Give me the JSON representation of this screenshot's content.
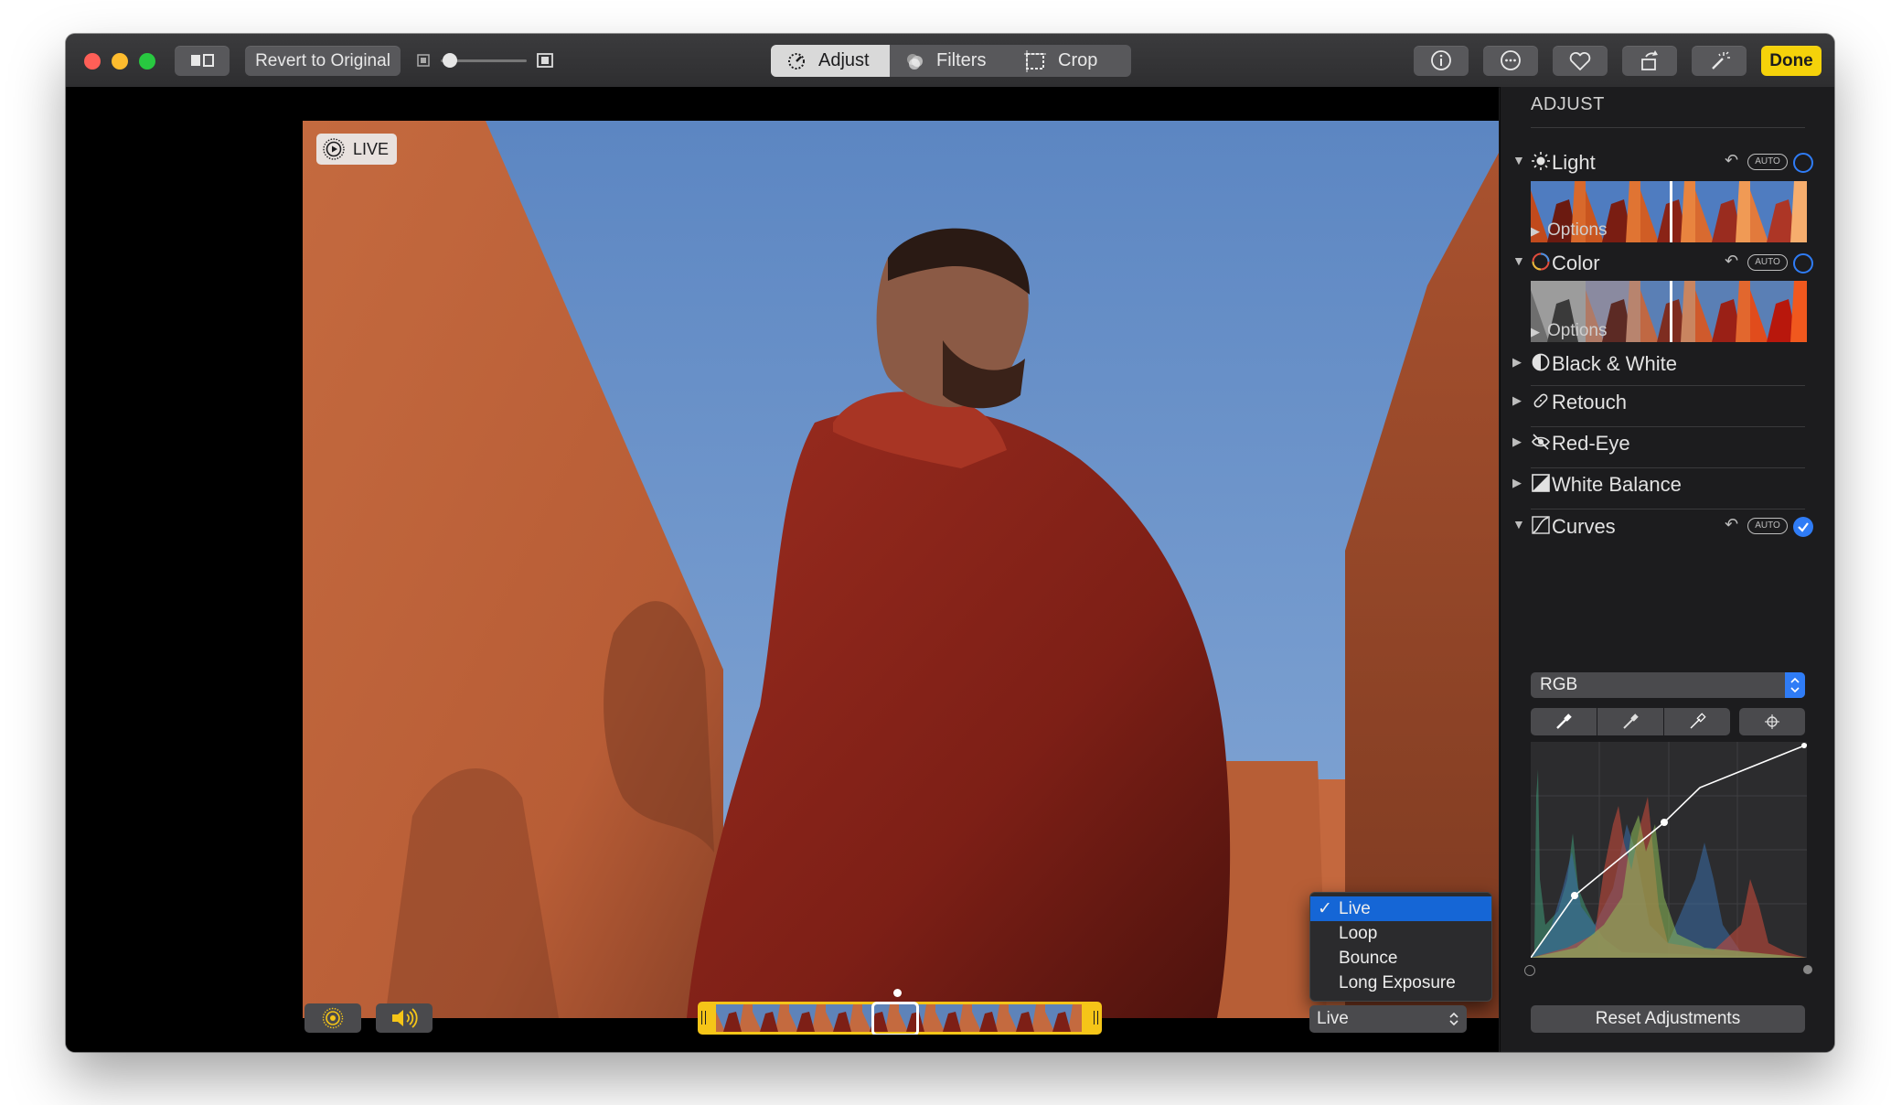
{
  "toolbar": {
    "revert_label": "Revert to Original",
    "zoom_level": 0.1,
    "tabs": [
      {
        "label": "Adjust",
        "icon": "adjust-dial-icon",
        "active": true
      },
      {
        "label": "Filters",
        "icon": "filters-icon",
        "active": false
      },
      {
        "label": "Crop",
        "icon": "crop-icon",
        "active": false
      }
    ],
    "right_icons": [
      "info-icon",
      "more-icon",
      "heart-icon",
      "rotate-icon",
      "magic-wand-icon"
    ],
    "done_label": "Done"
  },
  "viewer": {
    "live_badge": "LIVE",
    "live_menu": {
      "items": [
        "Live",
        "Loop",
        "Bounce",
        "Long Exposure"
      ],
      "selected": "Live"
    },
    "effect_dropdown": "Live"
  },
  "sidebar": {
    "header": "ADJUST",
    "light": {
      "label": "Light",
      "options": "Options",
      "auto": "AUTO"
    },
    "color": {
      "label": "Color",
      "options": "Options",
      "auto": "AUTO"
    },
    "black_white": "Black & White",
    "retouch": "Retouch",
    "red_eye": "Red-Eye",
    "white_balance": "White Balance",
    "curves": {
      "label": "Curves",
      "auto": "AUTO",
      "channel": "RGB"
    },
    "reset_label": "Reset Adjustments"
  },
  "colors": {
    "accent_blue": "#2f7cf6",
    "done_yellow": "#f5d20a",
    "menu_selection": "#1566d6",
    "wall_orange": "#c96a3e",
    "sky_blue": "#6f97c9",
    "shirt_red": "#8e2218"
  }
}
